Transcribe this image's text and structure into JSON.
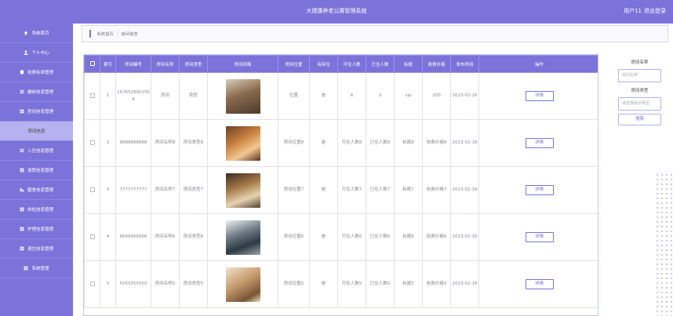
{
  "header": {
    "title": "大健康养老公寓管理系统",
    "user": "用户11",
    "logout": "退出登录"
  },
  "sidebar": {
    "items": [
      {
        "label": "系统首页",
        "icon": "home-icon"
      },
      {
        "label": "个人中心",
        "icon": "user-icon"
      },
      {
        "label": "收费标准管理",
        "icon": "doc-icon"
      },
      {
        "label": "缴纳信息管理",
        "icon": "list-icon"
      },
      {
        "label": "房间信息管理",
        "icon": "grid-icon"
      },
      {
        "label": "房间信息",
        "icon": "",
        "active": true
      },
      {
        "label": "入住信息管理",
        "icon": "list-icon"
      },
      {
        "label": "请假信息管理",
        "icon": "grid-icon"
      },
      {
        "label": "膳食信息管理",
        "icon": "chart-icon"
      },
      {
        "label": "体检信息管理",
        "icon": "grid-icon"
      },
      {
        "label": "护理信息管理",
        "icon": "grid-icon"
      },
      {
        "label": "退住信息管理",
        "icon": "grid-icon"
      },
      {
        "label": "系统管理",
        "icon": "grid-icon"
      }
    ]
  },
  "breadcrumb": {
    "home": "系统首页",
    "sep": "/",
    "current": "房间信息"
  },
  "table": {
    "headers": [
      "索引",
      "房间编号",
      "房间名称",
      "房间类型",
      "房间封面",
      "房间位置",
      "有床位",
      "可住人数",
      "已住人数",
      "标题",
      "收费价格",
      "发布时间",
      "操作"
    ],
    "rows": [
      {
        "idx": "1",
        "code": "1676528902959",
        "name": "房间",
        "type": "类型",
        "pos": "位置",
        "bed": "是",
        "cap": "6",
        "occ": "3",
        "title": "vip",
        "price": "200",
        "date": "2023-02-16",
        "action": "详情"
      },
      {
        "idx": "2",
        "code": "8888888888",
        "name": "房间名称8",
        "type": "房间类型8",
        "pos": "房间位置8",
        "bed": "是",
        "cap": "可住人数8",
        "occ": "已住人数8",
        "title": "标题8",
        "price": "收费价格8",
        "date": "2023-02-16",
        "action": "详情"
      },
      {
        "idx": "3",
        "code": "7777777777",
        "name": "房间名称7",
        "type": "房间类型7",
        "pos": "房间位置7",
        "bed": "是",
        "cap": "可住人数7",
        "occ": "已住人数7",
        "title": "标题7",
        "price": "收费价格7",
        "date": "2023-02-16",
        "action": "详情"
      },
      {
        "idx": "4",
        "code": "6666666666",
        "name": "房间名称6",
        "type": "房间类型6",
        "pos": "房间位置6",
        "bed": "是",
        "cap": "可住人数6",
        "occ": "已住人数6",
        "title": "标题6",
        "price": "收费价格6",
        "date": "2023-02-16",
        "action": "详情"
      },
      {
        "idx": "5",
        "code": "5555555555",
        "name": "房间名称5",
        "type": "房间类型5",
        "pos": "房间位置5",
        "bed": "是",
        "cap": "可住人数5",
        "occ": "已住人数5",
        "title": "标题5",
        "price": "收费价格5",
        "date": "2023-02-16",
        "action": "详情"
      }
    ]
  },
  "search": {
    "name_label": "房间名称",
    "name_placeholder": "房间名称",
    "type_label": "房间类型",
    "type_placeholder": "请选择房间类型",
    "button": "搜索"
  },
  "colors": {
    "accent": "#7b73d9",
    "active": "#b6b1ef"
  }
}
